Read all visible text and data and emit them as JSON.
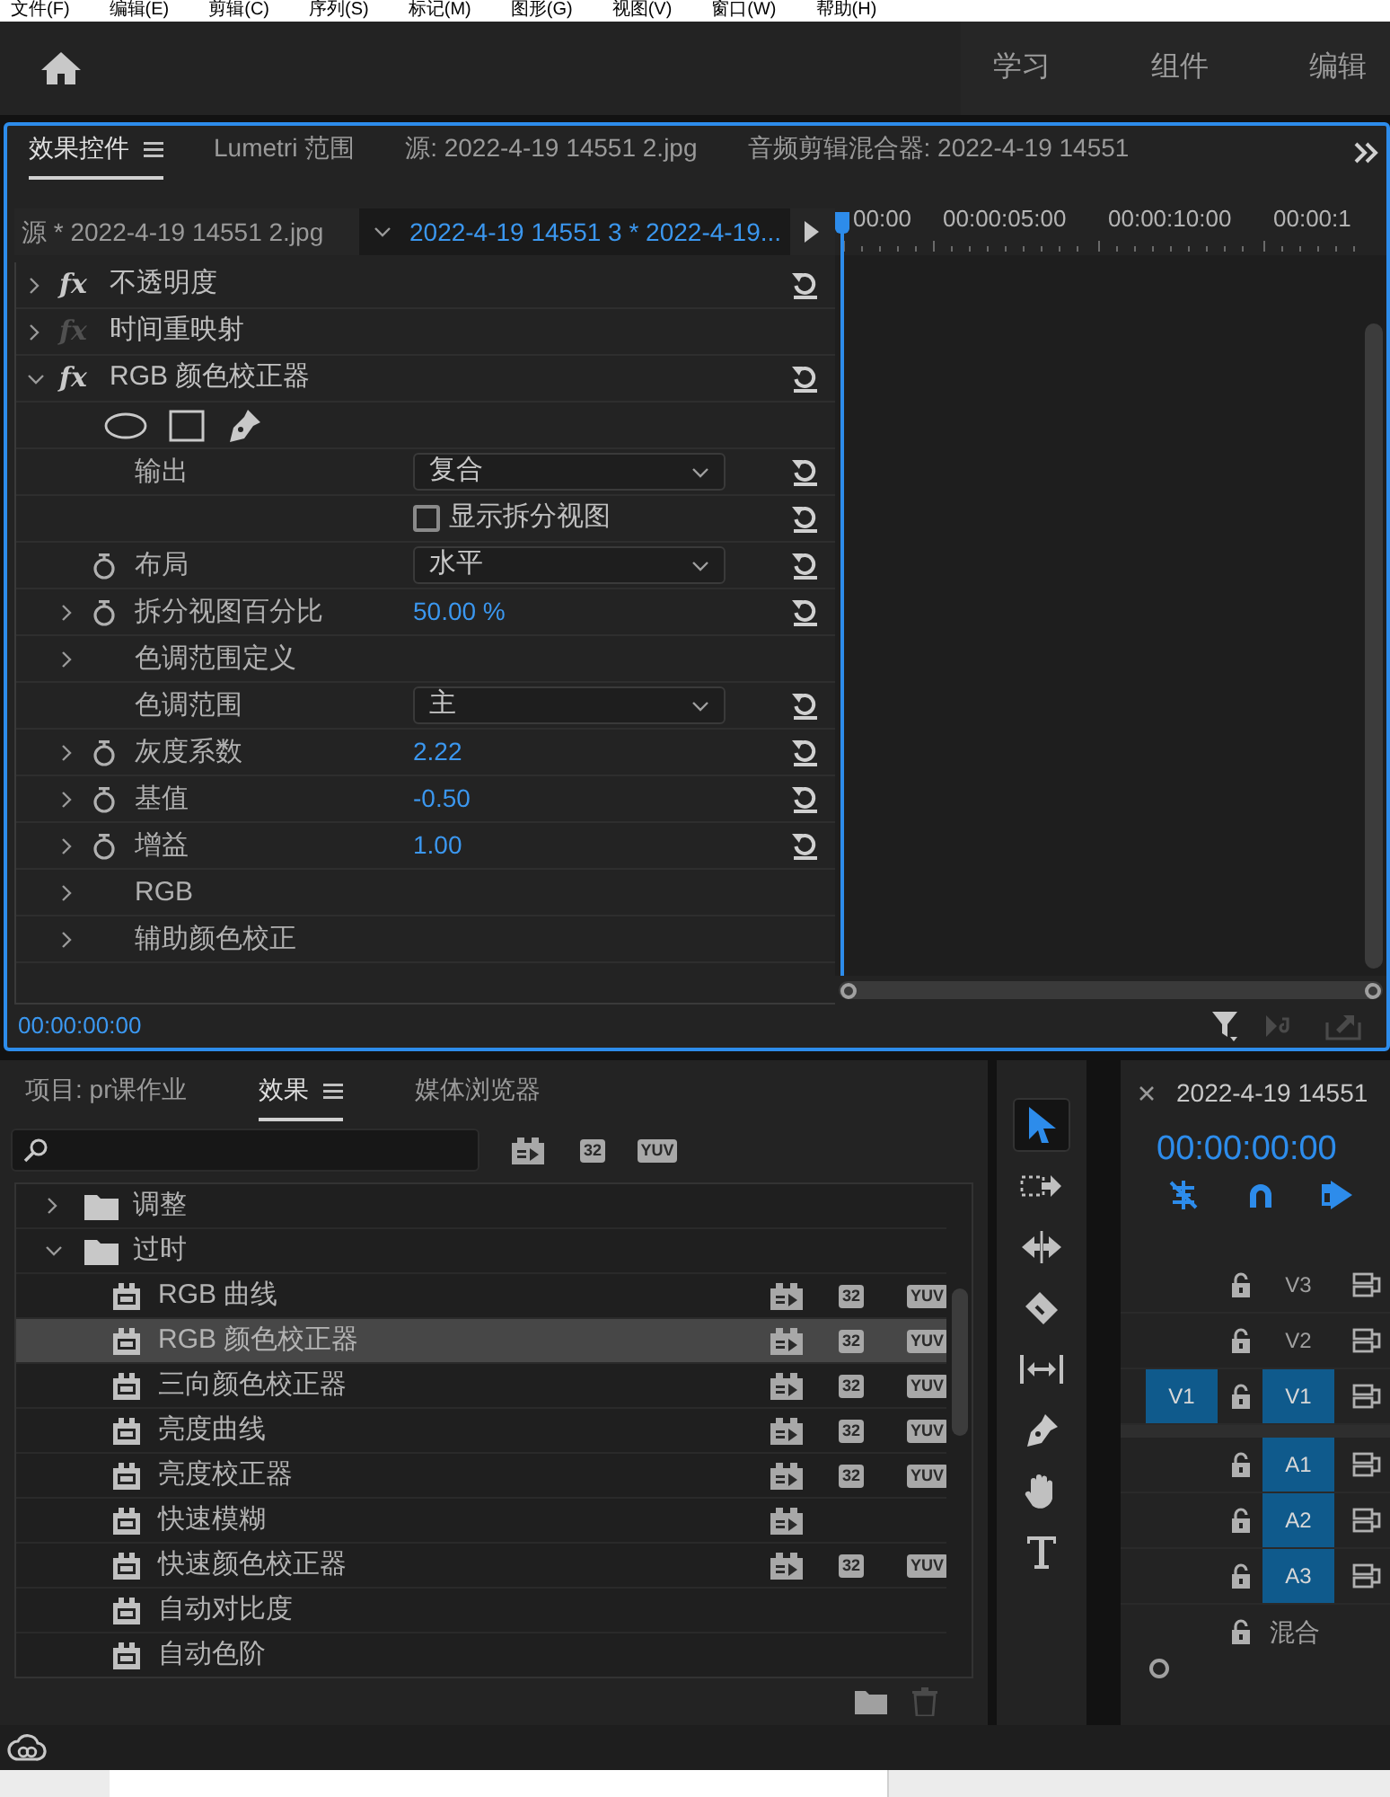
{
  "menu_bar": [
    "文件(F)",
    "编辑(E)",
    "剪辑(C)",
    "序列(S)",
    "标记(M)",
    "图形(G)",
    "视图(V)",
    "窗口(W)",
    "帮助(H)"
  ],
  "workspaces": [
    "学习",
    "组件",
    "编辑"
  ],
  "effect_panel": {
    "tabs": [
      {
        "label": "效果控件",
        "selected": true,
        "menu": true
      },
      {
        "label": "Lumetri 范围",
        "selected": false
      },
      {
        "label": "源: 2022-4-19 14551 2.jpg",
        "selected": false
      },
      {
        "label": "音频剪辑混合器: 2022-4-19 14551",
        "selected": false
      }
    ],
    "source_label": "源 * 2022-4-19 14551 2.jpg",
    "sequence_label": "2022-4-19 14551 3 * 2022-4-19...",
    "ruler_times": [
      "00:00",
      "00:00:05:00",
      "00:00:10:00",
      "00:00:1"
    ],
    "rows": [
      {
        "kind": "effect",
        "fx": "fx",
        "fx_enabled": true,
        "label": "不透明度",
        "expanded": false,
        "reset": true
      },
      {
        "kind": "effect",
        "fx": "fx",
        "fx_enabled": false,
        "label": "时间重映射",
        "expanded": false
      },
      {
        "kind": "effect",
        "fx": "fx",
        "fx_enabled": true,
        "label": "RGB 颜色校正器",
        "expanded": true,
        "reset": true,
        "children": [
          {
            "kind": "shapes"
          },
          {
            "kind": "dropdown",
            "label": "输出",
            "value": "复合",
            "reset": true
          },
          {
            "kind": "checkbox",
            "label": "显示拆分视图",
            "checked": false,
            "reset": true
          },
          {
            "kind": "dropdown",
            "label": "布局",
            "value": "水平",
            "stopwatch": true,
            "reset": true
          },
          {
            "kind": "value",
            "label": "拆分视图百分比",
            "value": "50.00 %",
            "stopwatch": true,
            "expanded": false,
            "reset": true
          },
          {
            "kind": "group",
            "label": "色调范围定义",
            "expanded": false
          },
          {
            "kind": "dropdown",
            "label": "色调范围",
            "value": "主",
            "reset": true
          },
          {
            "kind": "value",
            "label": "灰度系数",
            "value": "2.22",
            "stopwatch": true,
            "expanded": false,
            "reset": true
          },
          {
            "kind": "value",
            "label": "基值",
            "value": "-0.50",
            "stopwatch": true,
            "expanded": false,
            "reset": true
          },
          {
            "kind": "value",
            "label": "增益",
            "value": "1.00",
            "stopwatch": true,
            "expanded": false,
            "reset": true
          },
          {
            "kind": "group",
            "label": "RGB",
            "expanded": false
          },
          {
            "kind": "group",
            "label": "辅助颜色校正",
            "expanded": false
          }
        ]
      }
    ],
    "timecode": "00:00:00:00"
  },
  "project_panel": {
    "tabs": [
      {
        "label": "项目: pr课作业",
        "selected": false
      },
      {
        "label": "效果",
        "selected": true,
        "menu": true
      },
      {
        "label": "媒体浏览器",
        "selected": false
      }
    ],
    "filters": [
      {
        "kind": "accelerated"
      },
      {
        "kind": "bit32",
        "label": "32"
      },
      {
        "kind": "yuv",
        "label": "YUV"
      }
    ],
    "tree": [
      {
        "label": "调整",
        "expanded": false,
        "selected": false
      },
      {
        "label": "过时",
        "expanded": true,
        "selected": false,
        "children": [
          {
            "label": "RGB 曲线",
            "selected": false,
            "badges": [
              {
                "kind": "accelerated"
              },
              {
                "kind": "bit32",
                "label": "32"
              },
              {
                "kind": "yuv",
                "label": "YUV"
              }
            ]
          },
          {
            "label": "RGB 颜色校正器",
            "selected": true,
            "badges": [
              {
                "kind": "accelerated"
              },
              {
                "kind": "bit32",
                "label": "32"
              },
              {
                "kind": "yuv",
                "label": "YUV"
              }
            ]
          },
          {
            "label": "三向颜色校正器",
            "selected": false,
            "badges": [
              {
                "kind": "accelerated"
              },
              {
                "kind": "bit32",
                "label": "32"
              },
              {
                "kind": "yuv",
                "label": "YUV"
              }
            ]
          },
          {
            "label": "亮度曲线",
            "selected": false,
            "badges": [
              {
                "kind": "accelerated"
              },
              {
                "kind": "bit32",
                "label": "32"
              },
              {
                "kind": "yuv",
                "label": "YUV"
              }
            ]
          },
          {
            "label": "亮度校正器",
            "selected": false,
            "badges": [
              {
                "kind": "accelerated"
              },
              {
                "kind": "bit32",
                "label": "32"
              },
              {
                "kind": "yuv",
                "label": "YUV"
              }
            ]
          },
          {
            "label": "快速模糊",
            "selected": false,
            "badges": [
              {
                "kind": "accelerated"
              }
            ]
          },
          {
            "label": "快速颜色校正器",
            "selected": false,
            "badges": [
              {
                "kind": "accelerated"
              },
              {
                "kind": "bit32",
                "label": "32"
              },
              {
                "kind": "yuv",
                "label": "YUV"
              }
            ]
          },
          {
            "label": "自动对比度",
            "selected": false
          },
          {
            "label": "自动色阶",
            "selected": false
          }
        ]
      }
    ]
  },
  "tools": [
    {
      "kind": "selection",
      "selected": true
    },
    {
      "kind": "track_select",
      "selected": false
    },
    {
      "kind": "ripple",
      "selected": false
    },
    {
      "kind": "razor",
      "selected": false
    },
    {
      "kind": "slip",
      "selected": false
    },
    {
      "kind": "pen",
      "selected": false
    },
    {
      "kind": "hand",
      "selected": false
    },
    {
      "kind": "type",
      "selected": false
    }
  ],
  "timeline": {
    "title": "2022-4-19 14551",
    "timecode": "00:00:00:00",
    "video_tracks": [
      {
        "label": "V3",
        "targeted": false
      },
      {
        "label": "V2",
        "targeted": false
      },
      {
        "label": "V1",
        "source": "V1",
        "targeted": true
      }
    ],
    "audio_tracks": [
      {
        "label": "A1",
        "targeted": true
      },
      {
        "label": "A2",
        "targeted": true
      },
      {
        "label": "A3",
        "targeted": true
      }
    ],
    "mix_label": "混合"
  }
}
